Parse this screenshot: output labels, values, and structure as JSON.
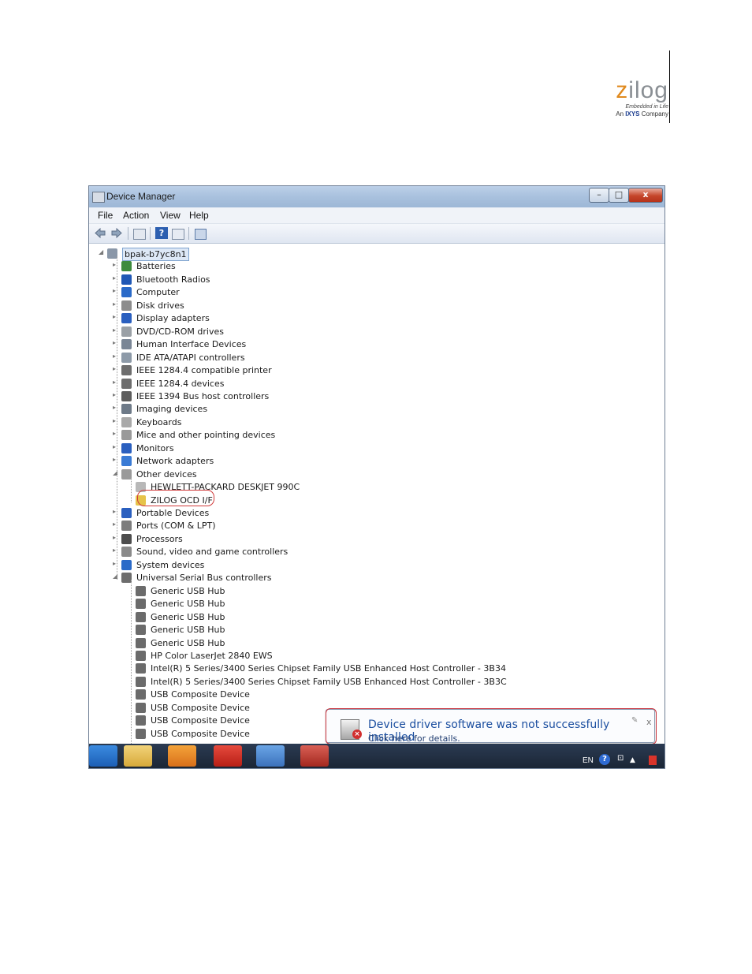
{
  "logo": {
    "word_accent": "z",
    "word_rest": "ilog",
    "tagline": "Embedded in Life",
    "company_prefix": "An",
    "company_brand": "IXYS",
    "company_suffix": "Company"
  },
  "window": {
    "title": "Device Manager",
    "min_label": "–",
    "max_label": "□",
    "close_label": "x"
  },
  "menu": {
    "items": [
      "File",
      "Action",
      "View",
      "Help"
    ]
  },
  "toolbar": {
    "help_label": "?"
  },
  "tree": {
    "root": "bpak-b7yc8n1",
    "categories": [
      {
        "label": "Batteries",
        "color": "#3d8b3d"
      },
      {
        "label": "Bluetooth Radios",
        "color": "#1f57b5"
      },
      {
        "label": "Computer",
        "color": "#2a6ac8"
      },
      {
        "label": "Disk drives",
        "color": "#8c8c8c"
      },
      {
        "label": "Display adapters",
        "color": "#2a5fbf"
      },
      {
        "label": "DVD/CD-ROM drives",
        "color": "#9aa0a6"
      },
      {
        "label": "Human Interface Devices",
        "color": "#7a8696"
      },
      {
        "label": "IDE ATA/ATAPI controllers",
        "color": "#8d9aa8"
      },
      {
        "label": "IEEE 1284.4 compatible printer",
        "color": "#6d6d6d"
      },
      {
        "label": "IEEE 1284.4 devices",
        "color": "#6d6d6d"
      },
      {
        "label": "IEEE 1394 Bus host controllers",
        "color": "#5d5d5d"
      },
      {
        "label": "Imaging devices",
        "color": "#6e7a88"
      },
      {
        "label": "Keyboards",
        "color": "#a9a9a9"
      },
      {
        "label": "Mice and other pointing devices",
        "color": "#9a9a9a"
      },
      {
        "label": "Monitors",
        "color": "#2a5fbf"
      },
      {
        "label": "Network adapters",
        "color": "#3a7bd5"
      },
      {
        "label": "Other devices",
        "color": "#9a9a9a"
      }
    ],
    "other_children": [
      {
        "label": "HEWLETT-PACKARD DESKJET 990C",
        "color": "#b8b8b8"
      },
      {
        "label": "ZILOG OCD I/F",
        "color": "#e6c34a"
      }
    ],
    "categories_after": [
      {
        "label": "Portable Devices",
        "color": "#2a5fbf"
      },
      {
        "label": "Ports (COM & LPT)",
        "color": "#7d7d7d"
      },
      {
        "label": "Processors",
        "color": "#4d4d4d"
      },
      {
        "label": "Sound, video and game controllers",
        "color": "#8a8a8a"
      },
      {
        "label": "System devices",
        "color": "#2a6ac8"
      },
      {
        "label": "Universal Serial Bus controllers",
        "color": "#6d6d6d"
      }
    ],
    "usb_children": [
      "Generic USB Hub",
      "Generic USB Hub",
      "Generic USB Hub",
      "Generic USB Hub",
      "Generic USB Hub",
      "HP Color LaserJet 2840 EWS",
      "Intel(R) 5 Series/3400 Series Chipset Family USB Enhanced Host Controller - 3B34",
      "Intel(R) 5 Series/3400 Series Chipset Family USB Enhanced Host Controller - 3B3C",
      "USB Composite Device",
      "USB Composite Device",
      "USB Composite Device",
      "USB Composite Device"
    ]
  },
  "balloon": {
    "title": "Device driver software was not successfully installed",
    "link": "Click here for details.",
    "close": "x"
  },
  "tray": {
    "lang": "EN",
    "help": "?"
  },
  "colors": {
    "accent_red": "#d13a3a",
    "link_blue": "#1c4fa0"
  }
}
